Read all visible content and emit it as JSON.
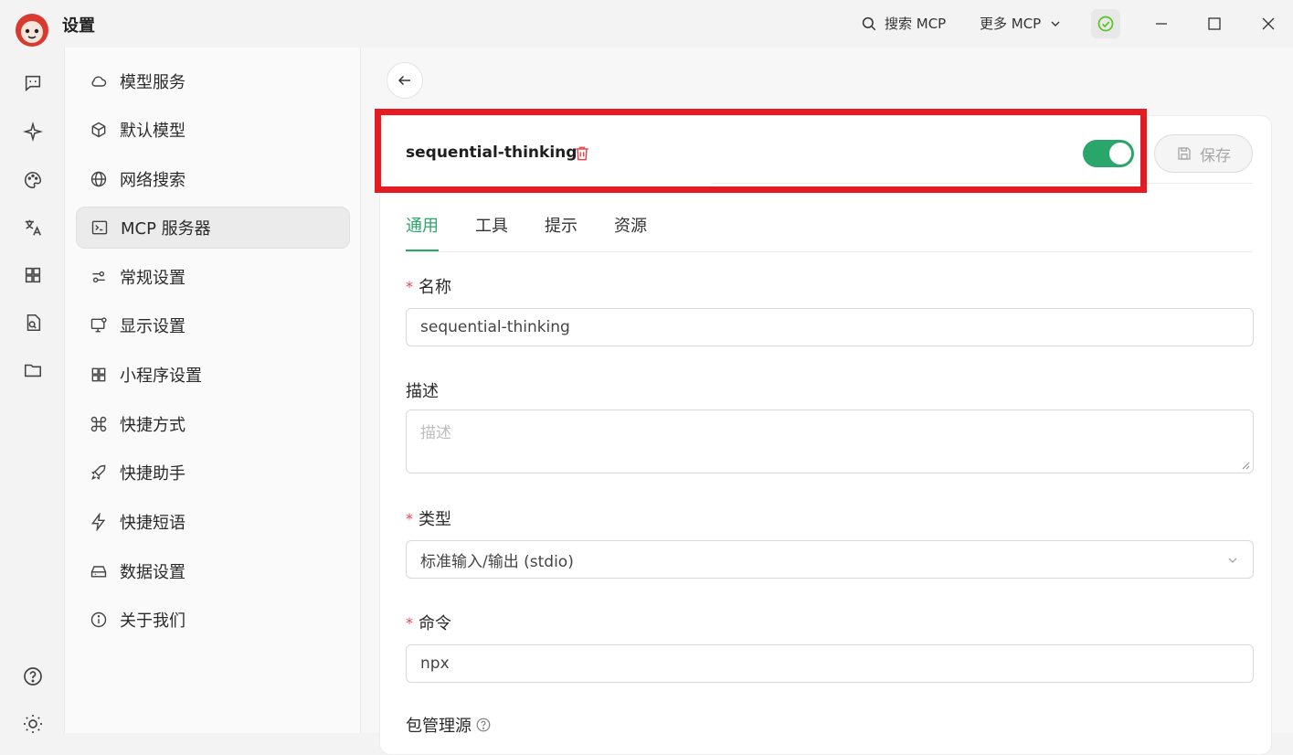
{
  "app": {
    "title": "设置"
  },
  "topbar": {
    "search_label": "搜索 MCP",
    "more_label": "更多 MCP"
  },
  "sidebar": {
    "items": [
      {
        "label": "模型服务",
        "icon": "cloud-icon"
      },
      {
        "label": "默认模型",
        "icon": "cube-icon"
      },
      {
        "label": "网络搜索",
        "icon": "globe-icon"
      },
      {
        "label": "MCP 服务器",
        "icon": "terminal-icon",
        "active": true
      },
      {
        "label": "常规设置",
        "icon": "sliders-icon"
      },
      {
        "label": "显示设置",
        "icon": "monitor-icon"
      },
      {
        "label": "小程序设置",
        "icon": "grid-icon"
      },
      {
        "label": "快捷方式",
        "icon": "command-icon"
      },
      {
        "label": "快捷助手",
        "icon": "rocket-icon"
      },
      {
        "label": "快捷短语",
        "icon": "zap-icon"
      },
      {
        "label": "数据设置",
        "icon": "drive-icon"
      },
      {
        "label": "关于我们",
        "icon": "info-icon"
      }
    ]
  },
  "server": {
    "title": "sequential-thinking",
    "enabled": true,
    "save_label": "保存"
  },
  "tabs": [
    {
      "label": "通用",
      "active": true
    },
    {
      "label": "工具"
    },
    {
      "label": "提示"
    },
    {
      "label": "资源"
    }
  ],
  "form": {
    "name_label": "名称",
    "name_value": "sequential-thinking",
    "desc_label": "描述",
    "desc_placeholder": "描述",
    "type_label": "类型",
    "type_value": "标准输入/输出 (stdio)",
    "command_label": "命令",
    "command_value": "npx",
    "pkg_label": "包管理源"
  },
  "colors": {
    "accent": "#2ba66a",
    "highlight": "#e31c23",
    "required": "#e5484d",
    "danger": "#e5484d"
  }
}
